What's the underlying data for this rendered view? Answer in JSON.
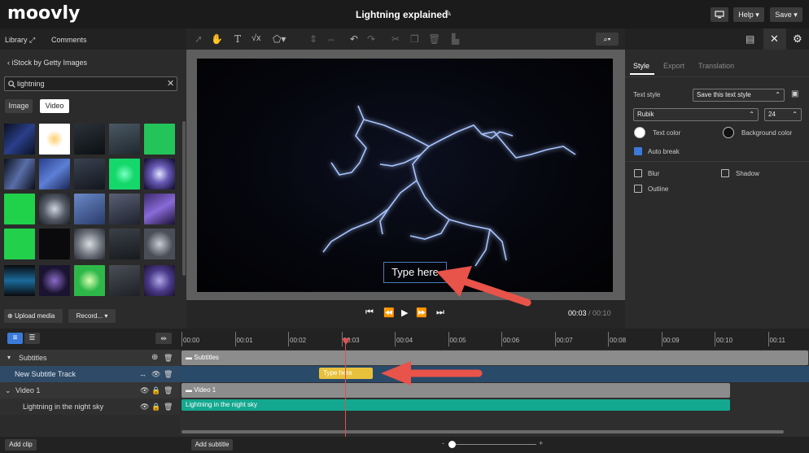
{
  "app": {
    "logo": "moovly",
    "title": "Lightning explained"
  },
  "topbar": {
    "help_label": "Help ▾",
    "save_label": "Save ▾"
  },
  "left_tabs": {
    "library": "Library",
    "comments": "Comments"
  },
  "library": {
    "back_label": "iStock by Getty Images",
    "search_value": "lightning",
    "filters": [
      "Image",
      "Video"
    ],
    "upload_label": "Upload media",
    "record_label": "Record... ▾"
  },
  "preview": {
    "overlay_text": "Type here",
    "time_current": "00:03",
    "time_total": "/ 00:10"
  },
  "right": {
    "tabs": [
      "Style",
      "Export",
      "Translation"
    ],
    "text_style_label": "Text style",
    "text_style_value": "Save this text style",
    "font_value": "Rubik",
    "font_size": "24",
    "text_color_label": "Text color",
    "bg_color_label": "Background color",
    "auto_break_label": "Auto break",
    "blur_label": "Blur",
    "shadow_label": "Shadow",
    "outline_label": "Outline"
  },
  "timeline": {
    "ticks": [
      "00:00",
      "00:01",
      "00:02",
      "00:03",
      "00:04",
      "00:05",
      "00:06",
      "00:07",
      "00:08",
      "00:09",
      "00:10",
      "00:11"
    ],
    "rows": [
      {
        "label": "Subtitles"
      },
      {
        "label": "New Subtitle Track"
      },
      {
        "label": "Video 1"
      },
      {
        "label": "Lightning in the night sky"
      }
    ],
    "clips": {
      "subtitles_group": "Subtitles",
      "subtitle_clip": "Type here",
      "video_group": "Video 1",
      "video_clip": "Lightning in the night sky"
    }
  },
  "bottom": {
    "add_clip": "Add clip",
    "add_subtitle": "Add subtitle"
  },
  "colors": {
    "accent_teal": "#13a88f",
    "subtitle_yellow": "#e8c13c",
    "arrow_red": "#e8534a",
    "selected_blue": "#2f5fa8"
  }
}
